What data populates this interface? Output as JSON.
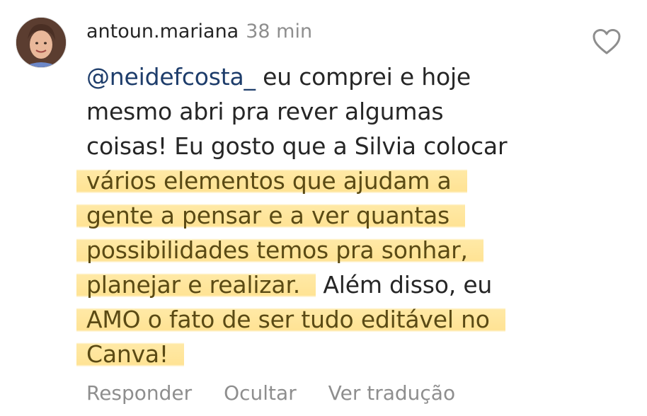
{
  "comment": {
    "username": "antoun.mariana",
    "timestamp": "38 min",
    "mention": "@neidefcosta_",
    "lines": [
      " eu comprei e hoje",
      "mesmo abri pra rever algumas",
      "coisas! Eu gosto que a Silvia colocar",
      "vários elementos que ajudam a",
      "gente a pensar e a ver quantas",
      "possibilidades temos pra sonhar,",
      "planejar e realizar.",
      " Além disso, eu",
      "AMO o fato de ser tudo editável no",
      "Canva!"
    ],
    "like_icon": "heart-outline-icon",
    "highlight_color": "#ffe08a"
  },
  "actions": {
    "reply": "Responder",
    "hide": "Ocultar",
    "translate": "Ver tradução"
  }
}
